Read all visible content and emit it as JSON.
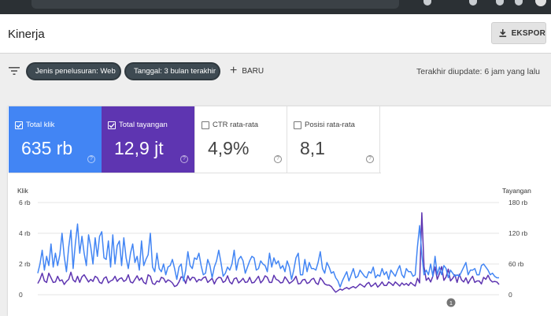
{
  "page": {
    "title": "Kinerja",
    "export_label": "EKSPOR"
  },
  "filters": {
    "chips": [
      {
        "label": "Jenis penelusuran: Web"
      },
      {
        "label": "Tanggal: 3 bulan terakhir"
      }
    ],
    "new_label": "BARU",
    "updated_text": "Terakhir diupdate: 6 jam yang lalu"
  },
  "metrics": [
    {
      "label": "Total klik",
      "value": "635 rb",
      "checked": true,
      "color": "#4285f4"
    },
    {
      "label": "Total tayangan",
      "value": "12,9 jt",
      "checked": true,
      "color": "#5e35b1"
    },
    {
      "label": "CTR rata-rata",
      "value": "4,9%",
      "checked": false
    },
    {
      "label": "Posisi rata-rata",
      "value": "8,1",
      "checked": false
    }
  ],
  "chart_data": {
    "type": "line",
    "left_axis": {
      "title": "Klik",
      "ticks": [
        "6 rb",
        "4 rb",
        "2 rb",
        "0"
      ],
      "range": [
        0,
        6000
      ]
    },
    "right_axis": {
      "title": "Tayangan",
      "ticks": [
        "180 rb",
        "120 rb",
        "60 rb",
        "0"
      ],
      "range": [
        0,
        180000
      ]
    },
    "grid": true,
    "annotation_marker": "1",
    "series": [
      {
        "color": "#4285f4",
        "axis": "left",
        "values": [
          1400,
          2000,
          2900,
          1600,
          2500,
          1900,
          3300,
          1800,
          2700,
          1900,
          2600,
          4000,
          2500,
          1500,
          3100,
          4200,
          1700,
          3300,
          4600,
          2700,
          3800,
          2700,
          1900,
          3900,
          3100,
          2000,
          3700,
          2500,
          3800,
          4100,
          2400,
          2300,
          3500,
          1800,
          3900,
          2000,
          3200,
          3500,
          1900,
          3700,
          2400,
          1700,
          2700,
          3300,
          2100,
          2500,
          1600,
          3500,
          1900,
          2300,
          2600,
          4000,
          1800,
          1500,
          2700,
          1700,
          1500,
          2000,
          1300,
          1800,
          1900,
          2300,
          1700,
          1000,
          1800,
          2000,
          900,
          1600,
          2800,
          1900,
          1700,
          2400,
          2300,
          2700,
          1900,
          1300,
          1400,
          2300,
          1900,
          1100,
          1800,
          2200,
          2900,
          2100,
          1200,
          1400,
          1800,
          1600,
          2000,
          2900,
          1600,
          2300,
          2500,
          2200,
          1400,
          1800,
          2200,
          2500,
          2400,
          1600,
          1700,
          2200,
          2000,
          1900,
          1500,
          2700,
          1800,
          2400,
          2000,
          2200,
          1700,
          1900,
          1500,
          2200,
          1800,
          1000,
          1600,
          2400,
          2700,
          1300,
          1300,
          2300,
          1500,
          2100,
          1700,
          1700,
          1600,
          2100,
          2800,
          1700,
          1400,
          2100,
          1800,
          1400,
          1500,
          1100,
          900,
          500,
          900,
          1200,
          1500,
          900,
          1300,
          1700,
          1100,
          1200,
          1600,
          1400,
          1200,
          1100,
          1500,
          1400,
          1800,
          1100,
          1300,
          1200,
          1700,
          1300,
          1500,
          1000,
          1600,
          1400,
          1200,
          1600,
          1900,
          1300,
          1100,
          1700,
          1500,
          1500,
          1200,
          1300,
          3100,
          4500,
          2600,
          1300,
          1600,
          1300,
          2000,
          1200,
          2500,
          1300,
          1800,
          1300,
          1900,
          1700,
          1100,
          1600,
          1400,
          1200,
          1300,
          1200,
          1500,
          1800,
          2100,
          1300,
          1600,
          1600,
          1700,
          1300,
          1300,
          1900,
          2000,
          1800,
          1600,
          1300,
          1400,
          1200,
          1100,
          1100
        ]
      },
      {
        "color": "#5e35b1",
        "axis": "right",
        "values": [
          22000,
          30000,
          42000,
          27000,
          24000,
          42000,
          33000,
          24000,
          25000,
          36000,
          27000,
          29000,
          20000,
          26000,
          30000,
          44000,
          29000,
          25000,
          36000,
          24000,
          35000,
          39000,
          32000,
          25000,
          30000,
          26000,
          36000,
          33000,
          24000,
          22000,
          32000,
          35000,
          23000,
          27000,
          29000,
          36000,
          26000,
          31000,
          33000,
          26000,
          29000,
          39000,
          25000,
          23000,
          30000,
          37000,
          28000,
          33000,
          24000,
          21000,
          39000,
          36000,
          22000,
          20000,
          27000,
          25000,
          34000,
          32000,
          24000,
          29000,
          27000,
          23000,
          16000,
          18000,
          25000,
          35000,
          33000,
          22000,
          37000,
          28000,
          34000,
          33000,
          25000,
          30000,
          28000,
          33000,
          35000,
          24000,
          28000,
          32000,
          21000,
          30000,
          34000,
          33000,
          24000,
          27000,
          37000,
          25000,
          21000,
          31000,
          33000,
          23000,
          27000,
          32000,
          24000,
          25000,
          34000,
          23000,
          24000,
          30000,
          36000,
          23000,
          28000,
          37000,
          34000,
          24000,
          24000,
          38000,
          30000,
          28000,
          23000,
          24000,
          35000,
          29000,
          22000,
          25000,
          29000,
          36000,
          21000,
          22000,
          29000,
          30000,
          22000,
          24000,
          30000,
          32000,
          23000,
          20000,
          33000,
          28000,
          21000,
          19000,
          19000,
          16000,
          10000,
          5000,
          8000,
          11000,
          9000,
          12000,
          14000,
          11000,
          14000,
          16000,
          13000,
          17000,
          21000,
          18000,
          15000,
          21000,
          24000,
          16000,
          19000,
          23000,
          15000,
          19000,
          25000,
          18000,
          18000,
          25000,
          22000,
          18000,
          25000,
          21000,
          17000,
          23000,
          19000,
          22000,
          18000,
          24000,
          20000,
          17000,
          32000,
          23000,
          160000,
          55000,
          28000,
          33000,
          25000,
          36000,
          54000,
          30000,
          41000,
          55000,
          28000,
          35000,
          50000,
          27000,
          32000,
          39000,
          24000,
          40000,
          29000,
          25000,
          33000,
          22000,
          30000,
          36000,
          24000,
          27000,
          27000,
          21000,
          34000,
          30000,
          38000,
          29000,
          25000,
          26000,
          25000,
          20000
        ]
      }
    ]
  }
}
